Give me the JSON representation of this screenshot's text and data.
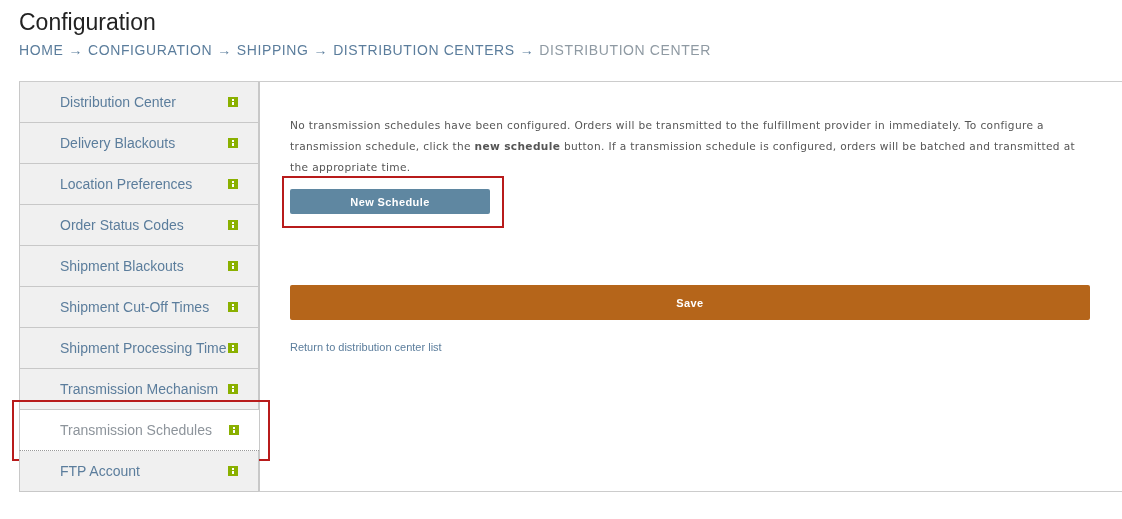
{
  "page_title": "Configuration",
  "breadcrumb": [
    {
      "label": "HOME",
      "current": false
    },
    {
      "label": "CONFIGURATION",
      "current": false
    },
    {
      "label": "SHIPPING",
      "current": false
    },
    {
      "label": "DISTRIBUTION CENTERS",
      "current": false
    },
    {
      "label": "DISTRIBUTION CENTER",
      "current": true
    }
  ],
  "breadcrumb_separator": "→",
  "tabs": [
    {
      "label": "Distribution Center",
      "selected": false,
      "highlighted": false
    },
    {
      "label": "Delivery Blackouts",
      "selected": false,
      "highlighted": false
    },
    {
      "label": "Location Preferences",
      "selected": false,
      "highlighted": false
    },
    {
      "label": "Order Status Codes",
      "selected": false,
      "highlighted": false
    },
    {
      "label": "Shipment Blackouts",
      "selected": false,
      "highlighted": false
    },
    {
      "label": "Shipment Cut-Off Times",
      "selected": false,
      "highlighted": false
    },
    {
      "label": "Shipment Processing Time",
      "selected": false,
      "highlighted": false
    },
    {
      "label": "Transmission Mechanism",
      "selected": false,
      "highlighted": false
    },
    {
      "label": "Transmission Schedules",
      "selected": true,
      "highlighted": true
    },
    {
      "label": "FTP Account",
      "selected": false,
      "highlighted": false
    }
  ],
  "message": "No transmission schedules have been configured. Orders will be transmitted to the fulfillment provider in immediately. To configure a transmission schedule, click the **new schedule** button. If a transmission schedule is configured, orders will be batched and transmitted at the appropriate time.",
  "new_schedule_button": {
    "label": "New Schedule",
    "highlighted": true
  },
  "save_button": "Save",
  "return_link": "Return to distribution center list"
}
